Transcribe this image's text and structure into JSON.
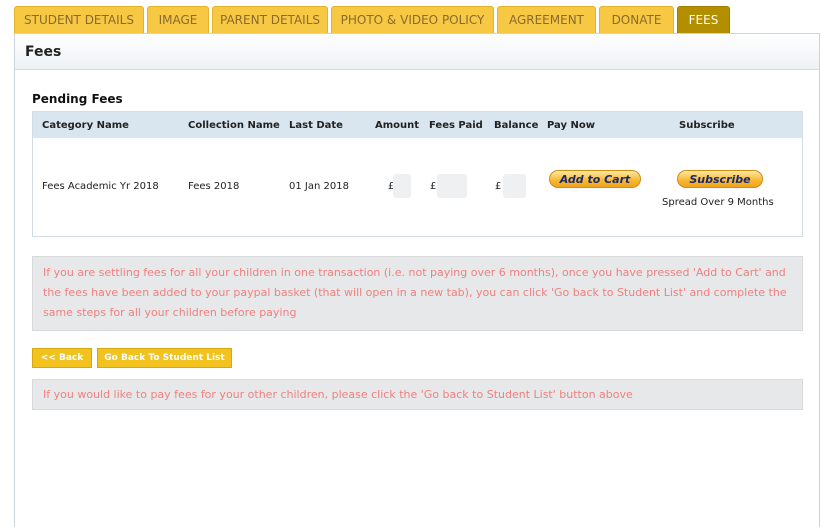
{
  "tabs": [
    {
      "label": "STUDENT DETAILS",
      "active": false
    },
    {
      "label": "IMAGE",
      "active": false
    },
    {
      "label": "PARENT DETAILS",
      "active": false
    },
    {
      "label": "PHOTO & VIDEO POLICY",
      "active": false
    },
    {
      "label": "AGREEMENT",
      "active": false
    },
    {
      "label": "DONATE",
      "active": false
    },
    {
      "label": "FEES",
      "active": true
    }
  ],
  "panel": {
    "title": "Fees"
  },
  "pending": {
    "title": "Pending Fees",
    "headers": [
      "Category Name",
      "Collection Name",
      "Last Date",
      "Amount",
      "Fees Paid",
      "Balance",
      "Pay Now",
      "Subscribe"
    ],
    "row": {
      "category": "Fees Academic Yr 2018",
      "collection": "Fees 2018",
      "last_date": "01 Jan 2018",
      "amount_symbol": "£",
      "paid_symbol": "£",
      "balance_symbol": "£",
      "add_to_cart": "Add to Cart",
      "subscribe": "Subscribe",
      "spread": "Spread Over 9 Months"
    }
  },
  "notice1": "If you are settling fees for all your children in one transaction (i.e. not paying over 6 months), once you have pressed 'Add to Cart' and the fees have been added to your paypal basket (that will open in a new tab), you can click 'Go back to Student List' and complete the same steps for all your children before paying",
  "buttons": {
    "back": "<< Back",
    "student_list": "Go Back To Student List"
  },
  "notice2": "If you would like to pay fees for your other children, please click the 'Go back to Student List' button above",
  "colors": {
    "tab": "#f7c843",
    "tab_active": "#b38f00",
    "notice_text": "#f08080",
    "header_row": "#d9e6f0"
  }
}
